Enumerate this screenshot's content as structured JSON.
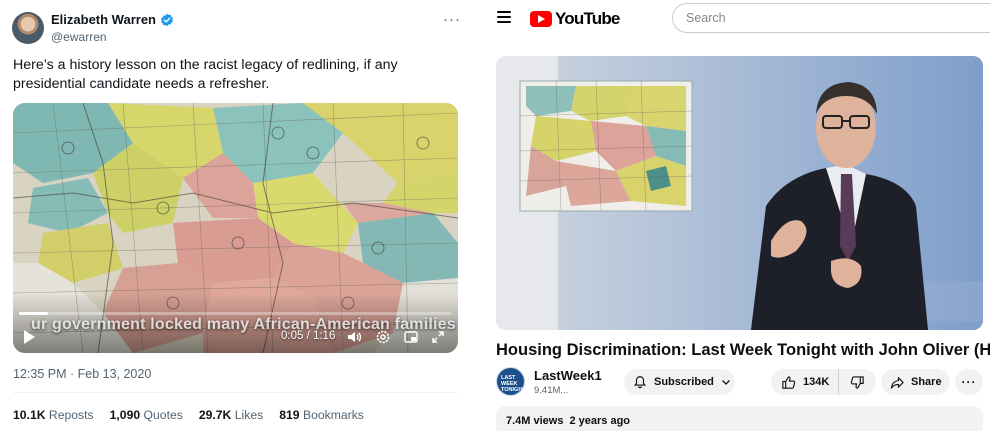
{
  "tweet": {
    "author_name": "Elizabeth Warren",
    "author_handle": "@ewarren",
    "more_label": "···",
    "text": "Here’s a history lesson on the racist legacy of redlining, if any presidential candidate needs a refresher.",
    "video": {
      "caption": "ur government locked many African-American families",
      "time": "0:05 / 1:16",
      "progress": 0.066
    },
    "timestamp": "12:35 PM · Feb 13, 2020",
    "stats": [
      {
        "value": "10.1K",
        "label": "Reposts"
      },
      {
        "value": "1,090",
        "label": "Quotes"
      },
      {
        "value": "29.7K",
        "label": "Likes"
      },
      {
        "value": "819",
        "label": "Bookmarks"
      }
    ],
    "icons": [
      "verified-badge-icon",
      "play-icon",
      "volume-icon",
      "settings-icon",
      "pip-icon",
      "fullscreen-icon"
    ]
  },
  "youtube": {
    "logo_text": "YouTube",
    "search_placeholder": "Search",
    "video_title": "Housing Discrimination: Last Week Tonight with John Oliver (HBO)",
    "channel": {
      "name": "LastWeek1",
      "subs": "9.41M...",
      "avatar_text": "LAST WEEK TONIGHT"
    },
    "subscribe_label": "Subscribed",
    "like_count": "134K",
    "share_label": "Share",
    "more_label": "···",
    "views": "7.4M views",
    "age": "2 years ago",
    "colors": {
      "brand": "#ff0000",
      "accent_blue": "#1d9bf0"
    },
    "icons": [
      "menu-icon",
      "bell-icon",
      "chevron-down-icon",
      "thumbs-up-icon",
      "thumbs-down-icon",
      "share-icon"
    ]
  }
}
